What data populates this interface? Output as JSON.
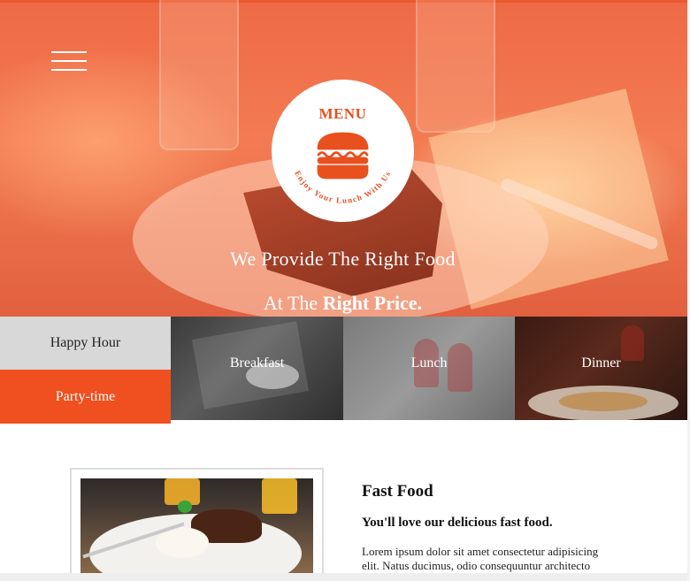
{
  "hero": {
    "logo": {
      "title": "MENU",
      "tagline": "Enjoy Your Lunch With Us"
    },
    "line1": "We Provide The Right Food",
    "line2_prefix": "At The ",
    "line2_emphasis": "Right Price."
  },
  "categories": {
    "happy_hour": "Happy Hour",
    "party_time": "Party-time",
    "tiles": [
      {
        "label": "Breakfast"
      },
      {
        "label": "Lunch"
      },
      {
        "label": "Dinner"
      }
    ]
  },
  "content": {
    "title": "Fast Food",
    "subtitle": "You'll love our delicious fast food.",
    "body": "Lorem ipsum dolor sit amet consectetur adipisicing elit. Natus ducimus, odio consequuntur architecto"
  },
  "colors": {
    "accent": "#f0501f",
    "hero_overlay": "#f06a45",
    "tile_gray": "#d8d8d8"
  },
  "icons": {
    "menu": "hamburger-menu-icon",
    "logo": "burger-icon"
  }
}
